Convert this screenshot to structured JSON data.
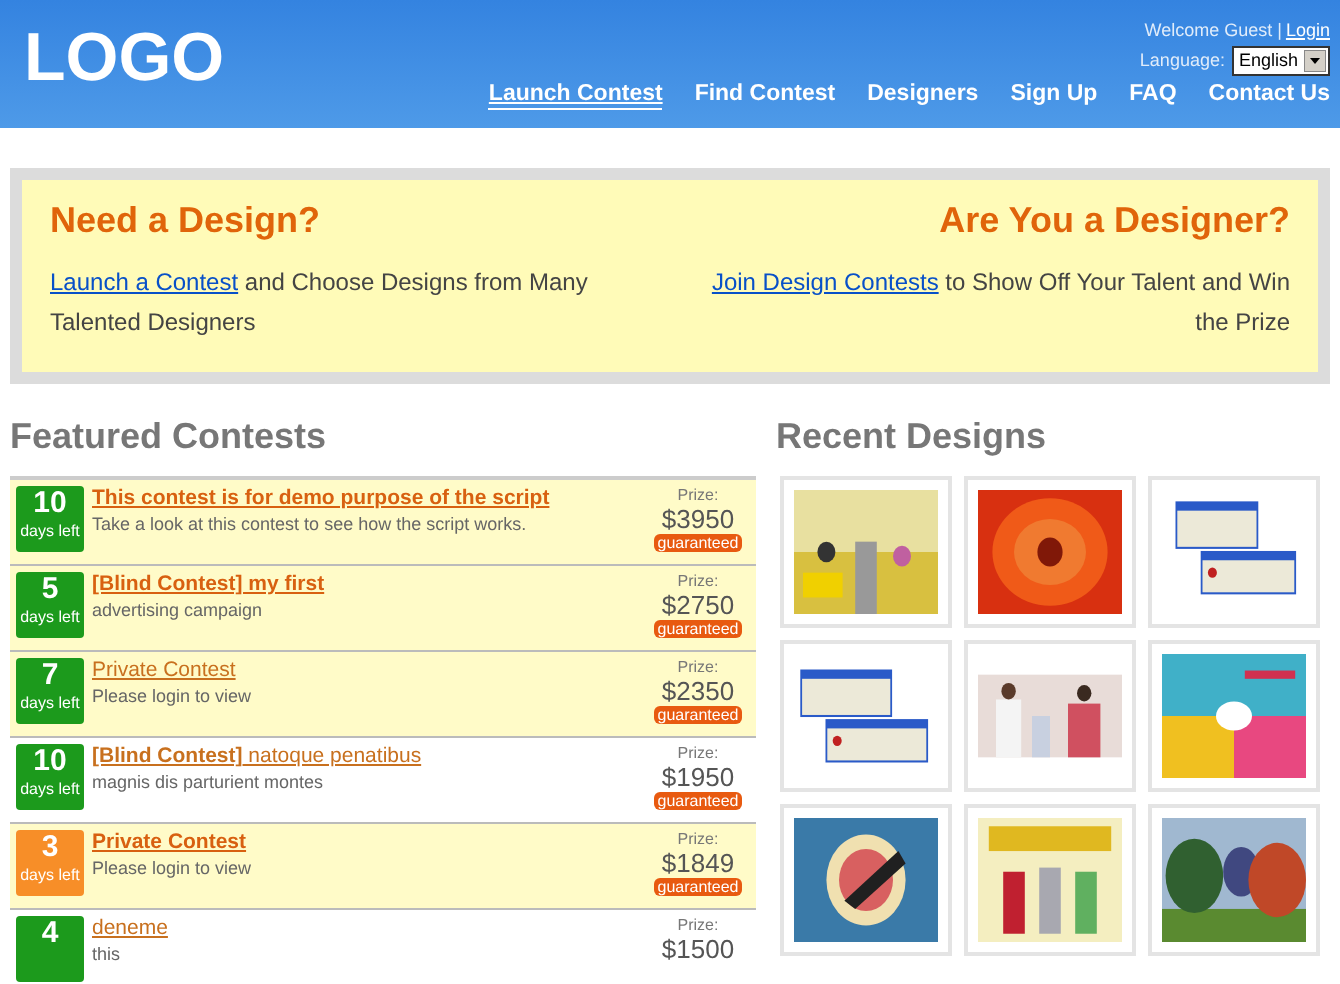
{
  "header": {
    "logo": "LOGO",
    "welcome": "Welcome Guest |",
    "login": "Login",
    "language_label": "Language:",
    "language": "English",
    "nav": [
      {
        "label": "Launch Contest",
        "selected": true
      },
      {
        "label": "Find Contest",
        "selected": false
      },
      {
        "label": "Designers",
        "selected": false
      },
      {
        "label": "Sign Up",
        "selected": false
      },
      {
        "label": "FAQ",
        "selected": false
      },
      {
        "label": "Contact Us",
        "selected": false
      }
    ]
  },
  "banner": [
    {
      "title": "Need a Design?",
      "link": "Launch a Contest",
      "text": "and Choose Designs from Many Talented Designers"
    },
    {
      "title": "Are You a Designer?",
      "link": "Join Design Contests",
      "text": "to Show Off Your Talent and Win the Prize"
    }
  ],
  "featured": {
    "title": "Featured Contests",
    "rows": [
      {
        "days": "10",
        "days_label": "days left",
        "urgent": false,
        "highlighted": true,
        "bold": true,
        "title": "This contest is for demo purpose of the script",
        "description": "Take a look at this contest to see how the script works.",
        "prize_label": "Prize:",
        "prize": "$3950",
        "badge": "guaranteed"
      },
      {
        "days": "5",
        "days_label": "days left",
        "urgent": false,
        "highlighted": true,
        "bold": true,
        "title": "[Blind Contest] my first",
        "description": "advertising campaign",
        "prize_label": "Prize:",
        "prize": "$2750",
        "badge": "guaranteed"
      },
      {
        "days": "7",
        "days_label": "days left",
        "urgent": false,
        "highlighted": true,
        "bold": false,
        "title": "Private Contest",
        "description": "Please login to view",
        "prize_label": "Prize:",
        "prize": "$2350",
        "badge": "guaranteed"
      },
      {
        "days": "10",
        "days_label": "days left",
        "urgent": false,
        "highlighted": false,
        "bold": false,
        "title": "**[Blind Contest]** natoque penatibus",
        "description": "magnis dis parturient montes",
        "prize_label": "Prize:",
        "prize": "$1950",
        "badge": "guaranteed"
      },
      {
        "days": "3",
        "days_label": "days left",
        "urgent": true,
        "highlighted": true,
        "bold": true,
        "title": "Private Contest",
        "description": "Please login to view",
        "prize_label": "Prize:",
        "prize": "$1849",
        "badge": "guaranteed"
      },
      {
        "days": "4",
        "highlighted": false,
        "urgent": false,
        "bold": false,
        "title": "deneme",
        "description": "this",
        "prize_label": "Prize:",
        "prize": "$1500"
      }
    ]
  },
  "recent": {
    "title": "Recent Designs"
  }
}
